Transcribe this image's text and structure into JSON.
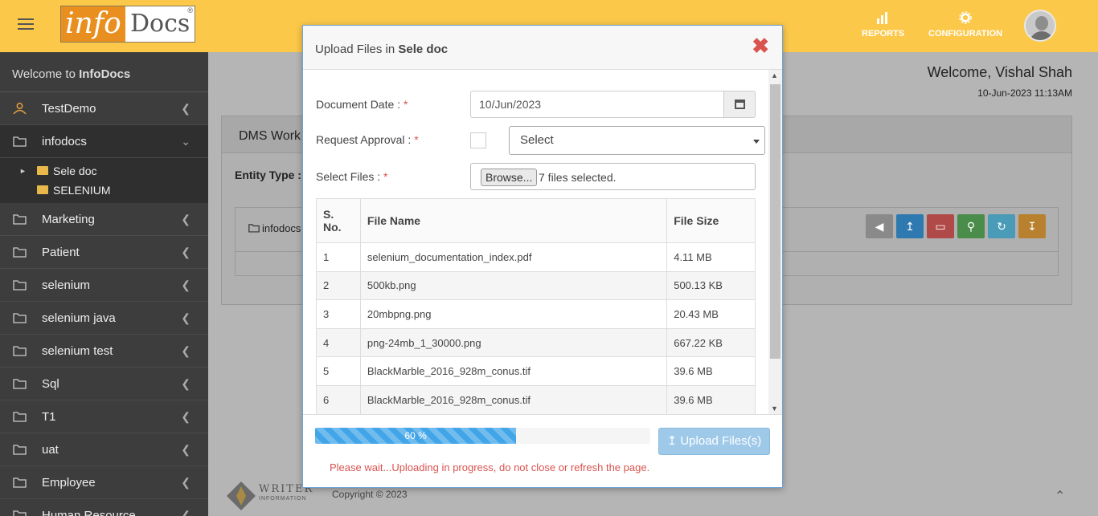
{
  "app": {
    "logo": {
      "info": "info",
      "docs": "Docs",
      "reg": "®"
    },
    "top_nav": [
      {
        "label": "REPORTS",
        "icon": "bar-chart-icon"
      },
      {
        "label": "CONFIGURATION",
        "icon": "gear-icon"
      }
    ],
    "welcome_prefix": "Welcome to ",
    "welcome_brand": "InfoDocs",
    "user_welcome": "Welcome, Vishal Shah",
    "user_time": "10-Jun-2023 11:13AM"
  },
  "sidebar": {
    "items": [
      {
        "label": "TestDemo",
        "icon": "user-icon"
      },
      {
        "label": "infodocs",
        "icon": "folder-icon",
        "expanded": true
      },
      {
        "label": "Marketing",
        "icon": "folder-icon"
      },
      {
        "label": "Patient",
        "icon": "folder-icon"
      },
      {
        "label": "selenium",
        "icon": "folder-icon"
      },
      {
        "label": "selenium java",
        "icon": "folder-icon"
      },
      {
        "label": "selenium test",
        "icon": "folder-icon"
      },
      {
        "label": "Sql",
        "icon": "folder-icon"
      },
      {
        "label": "T1",
        "icon": "folder-icon"
      },
      {
        "label": "uat",
        "icon": "folder-icon"
      },
      {
        "label": "Employee",
        "icon": "folder-icon"
      },
      {
        "label": "Human Resource",
        "icon": "folder-icon"
      }
    ],
    "sub_items": [
      {
        "label": "Sele doc"
      },
      {
        "label": "SELENIUM"
      }
    ]
  },
  "main": {
    "panel_title": "DMS Work",
    "entity_label": "Entity Type :",
    "crumb": "infodocs",
    "footer_copy": "Copyright © 2023",
    "footer_logo_text": "WRITER",
    "footer_logo_sub": "INFORMATION",
    "action_colors": [
      "#8a8a8a",
      "#2e7ab0",
      "#c9302c",
      "#449d44",
      "#31b0d5",
      "#ec971f"
    ]
  },
  "modal": {
    "title_prefix": "Upload Files in ",
    "title_folder": "Sele doc",
    "close": "✖",
    "document_date_label": "Document Date : ",
    "document_date_value": "10/Jun/2023",
    "request_approval_label": "Request Approval : ",
    "select_value": "Select",
    "select_files_label": "Select Files : ",
    "required_mark": "*",
    "browse_label": "Browse...",
    "files_selected": "7 files selected.",
    "table": {
      "headers": [
        "S. No.",
        "File Name",
        "File Size"
      ],
      "rows": [
        [
          "1",
          "selenium_documentation_index.pdf",
          "4.11 MB"
        ],
        [
          "2",
          "500kb.png",
          "500.13 KB"
        ],
        [
          "3",
          "20mbpng.png",
          "20.43 MB"
        ],
        [
          "4",
          "png-24mb_1_30000.png",
          "667.22 KB"
        ],
        [
          "5",
          "BlackMarble_2016_928m_conus.tif",
          "39.6 MB"
        ],
        [
          "6",
          "BlackMarble_2016_928m_conus.tif",
          "39.6 MB"
        ]
      ]
    },
    "progress_percent": 60,
    "progress_label": "60 %",
    "upload_button": "Upload Files(s)",
    "wait_message": "Please wait...Uploading in progress, do not close or refresh the page."
  }
}
